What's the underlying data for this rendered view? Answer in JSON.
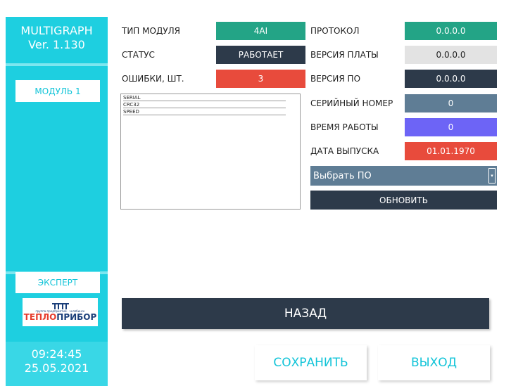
{
  "sidebar": {
    "app_name": "MULTIGRAPH",
    "version": "Ver. 1.130",
    "module_button": "МОДУЛЬ 1",
    "expert_button": "ЭКСПЕРТ",
    "logo": {
      "tagline": "группа предприятий · челябинск",
      "brand_part1": "ТЕПЛО",
      "brand_part2": "ПРИБОР",
      "brand_color1": "#e63c2d",
      "brand_color2": "#1b3f7a"
    },
    "time": "09:24:45",
    "date": "25.05.2021"
  },
  "left_info": [
    {
      "label": "ТИП МОДУЛЯ",
      "value": "4AI"
    },
    {
      "label": "СТАТУС",
      "value": "РАБОТАЕТ"
    },
    {
      "label": "ОШИБКИ, ШТ.",
      "value": "3"
    }
  ],
  "list_items": [
    "SERIAL",
    "CRC32",
    "SPEED"
  ],
  "right_info": [
    {
      "label": "ПРОТОКОЛ",
      "value": "0.0.0.0"
    },
    {
      "label": "ВЕРСИЯ ПЛАТЫ",
      "value": "0.0.0.0"
    },
    {
      "label": "ВЕРСИЯ ПО",
      "value": "0.0.0.0"
    },
    {
      "label": "СЕРИЙНЫЙ НОМЕР",
      "value": "0"
    },
    {
      "label": "ВРЕМЯ РАБОТЫ",
      "value": "0"
    },
    {
      "label": "ДАТА ВЫПУСКА",
      "value": "01.01.1970"
    }
  ],
  "firmware_select": {
    "value": "Выбрать ПО"
  },
  "update_button": "ОБНОВИТЬ",
  "back_button": "НАЗАД",
  "save_button": "СОХРАНИТЬ",
  "exit_button": "ВЫХОД",
  "colors": {
    "sidebar": "#1ecfe0",
    "teal": "#23a486",
    "navy": "#2d3a4a",
    "red": "#e84b3c",
    "slate": "#5f7d95",
    "violet": "#6d64f6"
  }
}
